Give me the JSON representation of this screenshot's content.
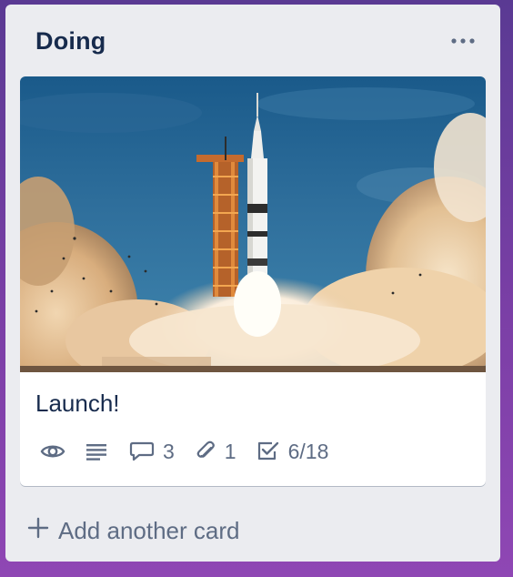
{
  "list": {
    "title": "Doing",
    "menu_icon": "more-horizontal-icon",
    "add_card_label": "Add another card",
    "add_card_icon": "plus-icon"
  },
  "card": {
    "title": "Launch!",
    "cover_image": "rocket-launch-photo",
    "badges": {
      "watching_icon": "eye-icon",
      "description_icon": "description-icon",
      "comments_icon": "comment-icon",
      "comments_count": "3",
      "attachments_icon": "paperclip-icon",
      "attachments_count": "1",
      "checklist_icon": "checklist-icon",
      "checklist_progress": "6/18"
    }
  },
  "colors": {
    "board_background": "#6b3fa0",
    "list_background": "#ebecf0",
    "title_text": "#172b4d",
    "badge_text": "#5e6c84"
  }
}
